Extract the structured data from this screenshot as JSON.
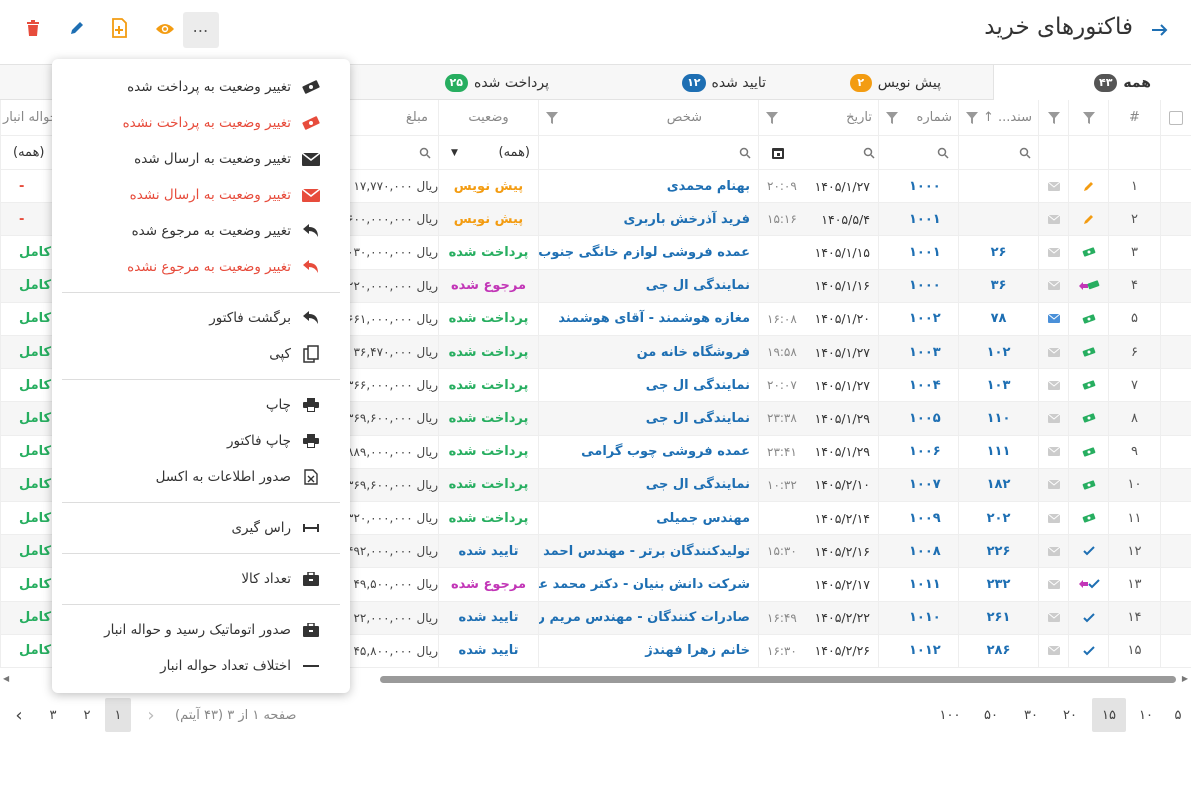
{
  "header": {
    "title": "فاکتورهای خرید"
  },
  "tabs": [
    {
      "label": "همه",
      "count": "۴۳",
      "color": "#555555",
      "active": true
    },
    {
      "label": "پیش نویس",
      "count": "۲",
      "color": "#f39c12",
      "active": false
    },
    {
      "label": "تایید شده",
      "count": "۱۲",
      "color": "#1e6fb3",
      "active": false
    },
    {
      "label": "پرداخت شده",
      "count": "۲۵",
      "color": "#27ae60",
      "active": false
    }
  ],
  "columns": {
    "index": "#",
    "doc": "سند...",
    "number": "شماره",
    "date": "تاریخ",
    "person": "شخص",
    "status": "وضعیت",
    "amount": "مبلغ",
    "warehouse": "حواله انبار"
  },
  "filters": {
    "status_value": "(همه)",
    "warehouse_value": "(همه)"
  },
  "rows": [
    {
      "i": "۱",
      "icon": "pencil",
      "mail": "gray",
      "doc": "",
      "number": "۱۰۰۰",
      "date": "۱۴۰۵/۱/۲۷",
      "time": "۲۰:۰۹",
      "person": "بهنام محمدی",
      "status": "پیش نویس",
      "st": "orange",
      "amount": "ریال ۱۷,۷۷۰,۰۰۰",
      "wh": "-",
      "whc": "red"
    },
    {
      "i": "۲",
      "icon": "pencil",
      "mail": "gray",
      "doc": "",
      "number": "۱۰۰۱",
      "date": "۱۴۰۵/۵/۴",
      "time": "۱۵:۱۶",
      "person": "فرید آذرخش باربری",
      "status": "پیش نویس",
      "st": "orange",
      "amount": "ریال ۶۰۰,۰۰۰,۰۰۰",
      "wh": "-",
      "whc": "red"
    },
    {
      "i": "۳",
      "icon": "money",
      "mail": "gray",
      "doc": "۲۶",
      "number": "۱۰۰۱",
      "date": "۱۴۰۵/۱/۱۵",
      "time": "",
      "person": "عمده فروشی لوازم خانگی جنوب",
      "status": "پرداخت شده",
      "st": "green",
      "amount": "ریال ۰۳۰,۰۰۰,۰۰۰",
      "wh": "کامل",
      "whc": "green"
    },
    {
      "i": "۴",
      "icon": "money-return",
      "mail": "gray",
      "doc": "۳۶",
      "number": "۱۰۰۰",
      "date": "۱۴۰۵/۱/۱۶",
      "time": "",
      "person": "نمایندگی ال جی",
      "status": "مرجوع شده",
      "st": "purple",
      "amount": "ریال ۲۲۰,۰۰۰,۰۰۰",
      "wh": "کامل",
      "whc": "green"
    },
    {
      "i": "۵",
      "icon": "money",
      "mail": "blue",
      "doc": "۷۸",
      "number": "۱۰۰۲",
      "date": "۱۴۰۵/۱/۲۰",
      "time": "۱۶:۰۸",
      "person": "مغازه هوشمند - آقای هوشمند",
      "status": "پرداخت شده",
      "st": "green",
      "amount": "ریال ۶۶۱,۰۰۰,۰۰۰",
      "wh": "کامل",
      "whc": "green"
    },
    {
      "i": "۶",
      "icon": "money",
      "mail": "gray",
      "doc": "۱۰۲",
      "number": "۱۰۰۳",
      "date": "۱۴۰۵/۱/۲۷",
      "time": "۱۹:۵۸",
      "person": "فروشگاه خانه من",
      "status": "پرداخت شده",
      "st": "green",
      "amount": "ریال ۳۶,۴۷۰,۰۰۰",
      "wh": "کامل",
      "whc": "green"
    },
    {
      "i": "۷",
      "icon": "money",
      "mail": "gray",
      "doc": "۱۰۳",
      "number": "۱۰۰۴",
      "date": "۱۴۰۵/۱/۲۷",
      "time": "۲۰:۰۷",
      "person": "نمایندگی ال جی",
      "status": "پرداخت شده",
      "st": "green",
      "amount": "ریال ۳۶۶,۰۰۰,۰۰۰",
      "wh": "کامل",
      "whc": "green"
    },
    {
      "i": "۸",
      "icon": "money",
      "mail": "gray",
      "doc": "۱۱۰",
      "number": "۱۰۰۵",
      "date": "۱۴۰۵/۱/۲۹",
      "time": "۲۳:۳۸",
      "person": "نمایندگی ال جی",
      "status": "پرداخت شده",
      "st": "green",
      "amount": "ریال ۳۶۹,۶۰۰,۰۰۰",
      "wh": "کامل",
      "whc": "green"
    },
    {
      "i": "۹",
      "icon": "money",
      "mail": "gray",
      "doc": "۱۱۱",
      "number": "۱۰۰۶",
      "date": "۱۴۰۵/۱/۲۹",
      "time": "۲۳:۴۱",
      "person": "عمده فروشی چوب گرامی",
      "status": "پرداخت شده",
      "st": "green",
      "amount": "ریال ۸۸۹,۰۰۰,۰۰۰",
      "wh": "کامل",
      "whc": "green"
    },
    {
      "i": "۱۰",
      "icon": "money",
      "mail": "gray",
      "doc": "۱۸۲",
      "number": "۱۰۰۷",
      "date": "۱۴۰۵/۲/۱۰",
      "time": "۱۰:۳۲",
      "person": "نمایندگی ال جی",
      "status": "پرداخت شده",
      "st": "green",
      "amount": "ریال ۳۶۹,۶۰۰,۰۰۰",
      "wh": "کامل",
      "whc": "green"
    },
    {
      "i": "۱۱",
      "icon": "money",
      "mail": "gray",
      "doc": "۲۰۲",
      "number": "۱۰۰۹",
      "date": "۱۴۰۵/۲/۱۴",
      "time": "",
      "person": "مهندس جمیلی",
      "status": "پرداخت شده",
      "st": "green",
      "amount": "ریال ۳۲۰,۰۰۰,۰۰۰",
      "wh": "کامل",
      "whc": "green"
    },
    {
      "i": "۱۲",
      "icon": "check",
      "mail": "gray",
      "doc": "۲۲۶",
      "number": "۱۰۰۸",
      "date": "۱۴۰۵/۲/۱۶",
      "time": "۱۵:۳۰",
      "person": "تولیدکنندگان برتر - مهندس احمد فرجی",
      "status": "تایید شده",
      "st": "blue",
      "amount": "ریال ۴۹۲,۰۰۰,۰۰۰",
      "wh": "کامل",
      "whc": "green"
    },
    {
      "i": "۱۳",
      "icon": "check-return",
      "mail": "gray",
      "doc": "۲۳۲",
      "number": "۱۰۱۱",
      "date": "۱۴۰۵/۲/۱۷",
      "time": "",
      "person": "شرکت دانش بنیان - دکتر محمد عباسی",
      "status": "مرجوع شده",
      "st": "purple",
      "amount": "ریال ۴۹,۵۰۰,۰۰۰",
      "wh": "کامل",
      "whc": "green"
    },
    {
      "i": "۱۴",
      "icon": "check",
      "mail": "gray",
      "doc": "۲۶۱",
      "number": "۱۰۱۰",
      "date": "۱۴۰۵/۲/۲۲",
      "time": "۱۶:۴۹",
      "person": "صادرات کنندگان - مهندس مریم راد",
      "status": "تایید شده",
      "st": "blue",
      "amount": "ریال ۲۲,۰۰۰,۰۰۰",
      "wh": "کامل",
      "whc": "green"
    },
    {
      "i": "۱۵",
      "icon": "check",
      "mail": "gray",
      "doc": "۲۸۶",
      "number": "۱۰۱۲",
      "date": "۱۴۰۵/۲/۲۶",
      "time": "۱۶:۳۰",
      "person": "خانم زهرا فهندژ",
      "status": "تایید شده",
      "st": "blue",
      "amount": "ریال ۴۵,۸۰۰,۰۰۰",
      "wh": "کامل",
      "whc": "green"
    }
  ],
  "menu": {
    "items": [
      {
        "label": "تغییر وضعیت به پرداخت شده",
        "icon": "money-icon",
        "red": false
      },
      {
        "label": "تغییر وضعیت به پرداخت نشده",
        "icon": "money-icon",
        "red": true
      },
      {
        "label": "تغییر وضعیت به ارسال شده",
        "icon": "mail-icon",
        "red": false
      },
      {
        "label": "تغییر وضعیت به ارسال نشده",
        "icon": "mail-icon",
        "red": true
      },
      {
        "label": "تغییر وضعیت به مرجوع شده",
        "icon": "return-icon",
        "red": false
      },
      {
        "label": "تغییر وضعیت به مرجوع نشده",
        "icon": "return-icon",
        "red": true
      },
      {
        "label": "برگشت فاکتور",
        "icon": "return-icon",
        "red": false
      },
      {
        "label": "کپی",
        "icon": "copy-icon",
        "red": false
      },
      {
        "label": "چاپ",
        "icon": "print-icon",
        "red": false
      },
      {
        "label": "چاپ فاکتور",
        "icon": "print-icon",
        "red": false
      },
      {
        "label": "صدور اطلاعات به اکسل",
        "icon": "excel-icon",
        "red": false
      },
      {
        "label": "راس گیری",
        "icon": "ruler-icon",
        "red": false
      },
      {
        "label": "تعداد کالا",
        "icon": "box-icon",
        "red": false
      },
      {
        "label": "صدور اتوماتیک رسید و حواله انبار",
        "icon": "box-icon",
        "red": false
      },
      {
        "label": "اختلاف تعداد حواله انبار",
        "icon": "minus-icon",
        "red": false
      }
    ]
  },
  "pager": {
    "info": "صفحه ۱ از ۳ (۴۳ آیتم)",
    "pages": [
      "۱",
      "۲",
      "۳"
    ],
    "sizes": [
      "۵",
      "۱۰",
      "۱۵",
      "۲۰",
      "۳۰",
      "۵۰",
      "۱۰۰"
    ],
    "selected_size": "۱۵"
  },
  "colors": {
    "primary": "#1e6fb3",
    "success": "#27ae60",
    "warning": "#f39c12",
    "danger": "#e74c3c",
    "returned": "#c236b7"
  }
}
